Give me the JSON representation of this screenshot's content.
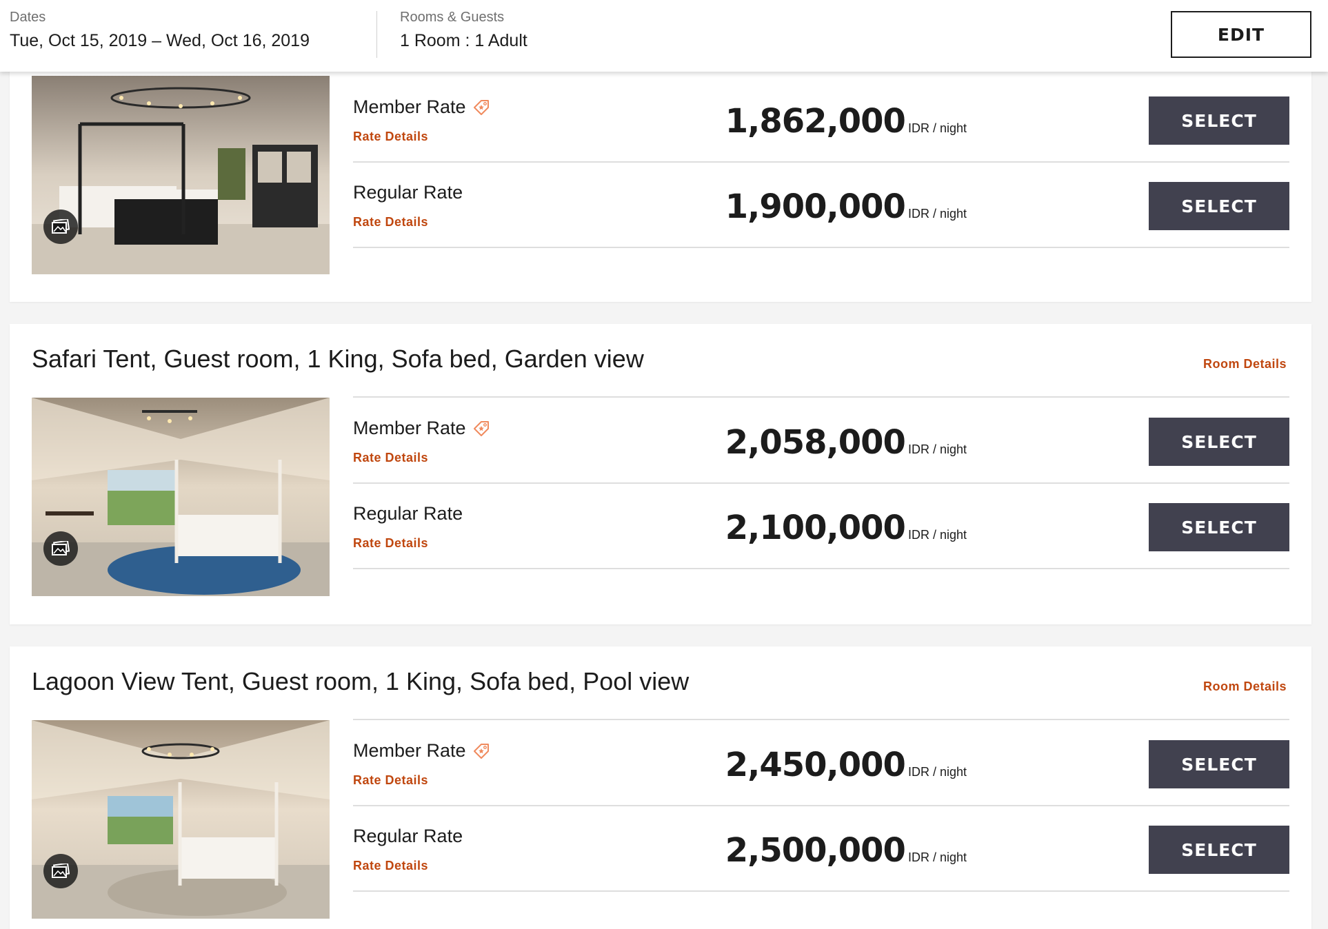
{
  "search_bar": {
    "dates_label": "Dates",
    "dates_value": "Tue, Oct 15, 2019 – Wed, Oct 16, 2019",
    "guests_label": "Rooms & Guests",
    "guests_value": "1 Room : 1 Adult",
    "edit_label": "EDIT"
  },
  "colors": {
    "accent_link": "#c0470f",
    "select_button": "#41414f",
    "member_tag_icon": "#f08a5d"
  },
  "rooms": [
    {
      "title": "",
      "details_label": "",
      "gallery_icon": "gallery-icon",
      "rates": [
        {
          "name": "Member Rate",
          "has_member_icon": true,
          "details_label": "Rate Details",
          "price": "1,862,000",
          "unit": "IDR / night",
          "button": "SELECT"
        },
        {
          "name": "Regular Rate",
          "has_member_icon": false,
          "details_label": "Rate Details",
          "price": "1,900,000",
          "unit": "IDR / night",
          "button": "SELECT"
        }
      ]
    },
    {
      "title": "Safari Tent, Guest room, 1 King, Sofa bed, Garden view",
      "details_label": "Room Details",
      "gallery_icon": "gallery-icon",
      "rates": [
        {
          "name": "Member Rate",
          "has_member_icon": true,
          "details_label": "Rate Details",
          "price": "2,058,000",
          "unit": "IDR / night",
          "button": "SELECT"
        },
        {
          "name": "Regular Rate",
          "has_member_icon": false,
          "details_label": "Rate Details",
          "price": "2,100,000",
          "unit": "IDR / night",
          "button": "SELECT"
        }
      ]
    },
    {
      "title": "Lagoon View Tent, Guest room, 1 King, Sofa bed, Pool view",
      "details_label": "Room Details",
      "gallery_icon": "gallery-icon",
      "rates": [
        {
          "name": "Member Rate",
          "has_member_icon": true,
          "details_label": "Rate Details",
          "price": "2,450,000",
          "unit": "IDR / night",
          "button": "SELECT"
        },
        {
          "name": "Regular Rate",
          "has_member_icon": false,
          "details_label": "Rate Details",
          "price": "2,500,000",
          "unit": "IDR / night",
          "button": "SELECT"
        }
      ]
    }
  ]
}
